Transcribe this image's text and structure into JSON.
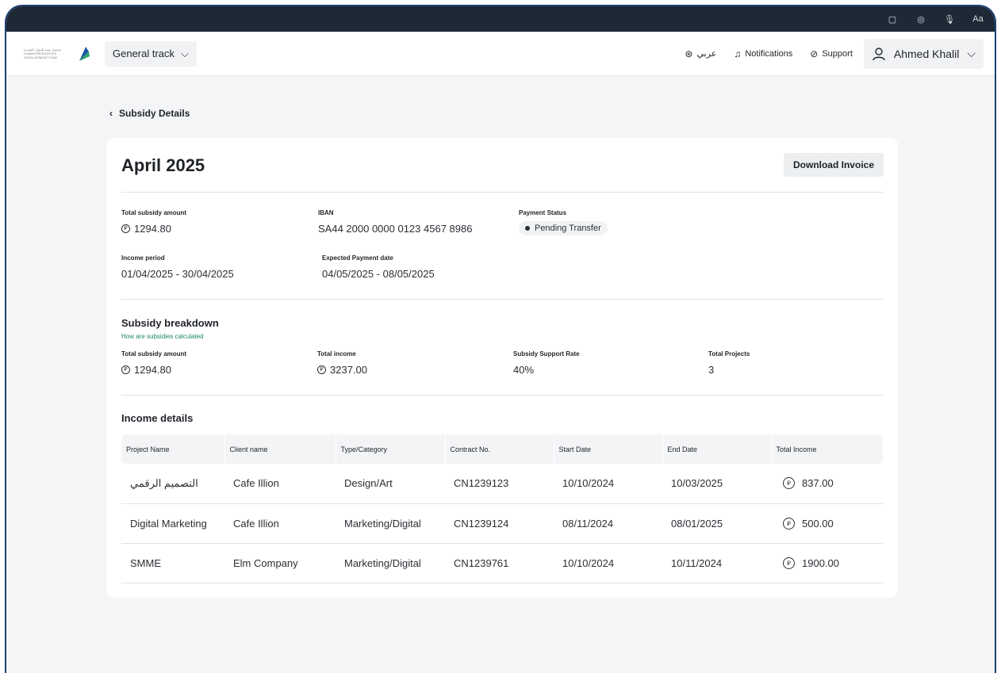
{
  "system_bar": {
    "icons": [
      "clipboard-icon",
      "eye-icon",
      "microphone-icon",
      "text-size-icon"
    ],
    "text_size_label": "Aa"
  },
  "topnav": {
    "logo_text": "صندوق تنمية الموارد البشرية HUMAN RESOURCES DEVELOPMENT FUND",
    "track_label": "General track",
    "language_label": "عربي",
    "notifications_label": "Notifications",
    "support_label": "Support",
    "user_name": "Ahmed Khalil"
  },
  "page": {
    "back_label": "Subsidy Details",
    "title": "April 2025",
    "download_label": "Download Invoice"
  },
  "summary": {
    "total_subsidy_label": "Total subsidy amount",
    "total_subsidy_value": "1294.80",
    "iban_label": "IBAN",
    "iban_value": "SA44 2000 0000 0123 4567 8986",
    "payment_status_label": "Payment Status",
    "payment_status_value": "Pending Transfer",
    "income_period_label": "Income period",
    "income_period_value": "01/04/2025 - 30/04/2025",
    "expected_date_label": "Expected Payment date",
    "expected_date_value": "04/05/2025 - 08/05/2025"
  },
  "breakdown": {
    "title": "Subsidy breakdown",
    "calc_link": "How are subsidies calculated",
    "total_subsidy_label": "Total subsidy amount",
    "total_subsidy_value": "1294.80",
    "total_income_label": "Total income",
    "total_income_value": "3237.00",
    "rate_label": "Subsidy Support Rate",
    "rate_value": "40%",
    "projects_label": "Total Projects",
    "projects_value": "3"
  },
  "income_details": {
    "title": "Income details",
    "columns": [
      "Project Name",
      "Client name",
      "Type/Category",
      "Contract No.",
      "Start Date",
      "End Date",
      "Total Income"
    ],
    "rows": [
      [
        "التصميم الرقمي",
        "Cafe Illion",
        "Design/Art",
        "CN1239123",
        "10/10/2024",
        "10/03/2025",
        "837.00"
      ],
      [
        "Digital Marketing",
        "Cafe Illion",
        "Marketing/Digital",
        "CN1239124",
        "08/11/2024",
        "08/01/2025",
        "500.00"
      ],
      [
        "SMME",
        "Elm Company",
        "Marketing/Digital",
        "CN1239761",
        "10/10/2024",
        "10/11/2024",
        "1900.00"
      ]
    ]
  },
  "currency_symbol": "⃁",
  "colors": {
    "system_bar": "#1e2936",
    "frame_border": "#1e3f73",
    "link_green": "#1a8a5f",
    "background": "#f4f5f7"
  }
}
